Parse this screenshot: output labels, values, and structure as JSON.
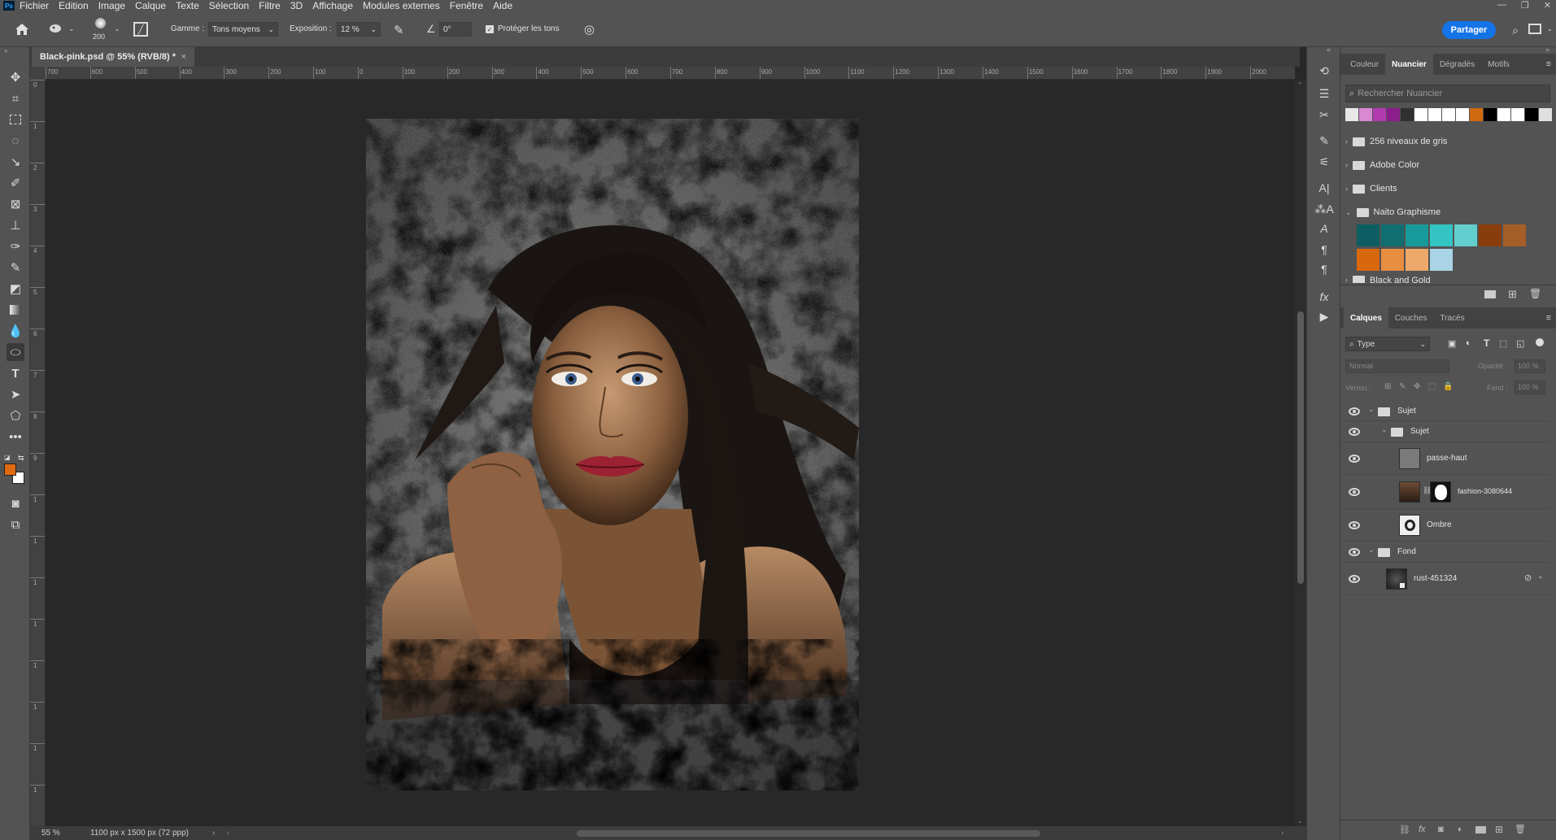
{
  "menubar": {
    "logo": "Ps",
    "items": [
      "Fichier",
      "Edition",
      "Image",
      "Calque",
      "Texte",
      "Sélection",
      "Filtre",
      "3D",
      "Affichage",
      "Modules externes",
      "Fenêtre",
      "Aide"
    ]
  },
  "options_bar": {
    "brush_size": "200",
    "range_label": "Gamme :",
    "range_value": "Tons moyens",
    "exposure_label": "Exposition :",
    "exposure_value": "12 %",
    "angle_value": "0°",
    "protect_tones_label": "Protéger les tons",
    "protect_tones_checked": true,
    "share_label": "Partager"
  },
  "document": {
    "tab_title": "Black-pink.psd @ 55% (RVB/8) *",
    "zoom": "55 %",
    "dimensions": "1100 px x 1500 px (72 ppp)"
  },
  "ruler": {
    "h_labels": [
      "700",
      "600",
      "500",
      "400",
      "300",
      "200",
      "100",
      "0",
      "100",
      "200",
      "300",
      "400",
      "500",
      "600",
      "700",
      "800",
      "900",
      "1000",
      "1100",
      "1200",
      "1300",
      "1400",
      "1500",
      "1600",
      "1700",
      "1800",
      "1900",
      "2000"
    ],
    "v_labels": [
      "0",
      "1",
      "2",
      "3",
      "4",
      "5",
      "6",
      "7",
      "8",
      "9",
      "1",
      "1",
      "1",
      "1",
      "1",
      "1",
      "1",
      "1"
    ]
  },
  "swatches_panel": {
    "tabs": [
      "Couleur",
      "Nuancier",
      "Dégradés",
      "Motifs"
    ],
    "active_tab": "Nuancier",
    "search_placeholder": "Rechercher Nuancier",
    "recent_colors": [
      "#e8e8e8",
      "#d88ad0",
      "#b03aae",
      "#8c1d8c",
      "#303030",
      "#ffffff",
      "#ffffff",
      "#ffffff",
      "#ffffff",
      "#d06a10",
      "#000000",
      "#ffffff",
      "#ffffff",
      "#000000",
      "#e0e0e0"
    ],
    "groups": [
      {
        "name": "256 niveaux de gris",
        "expanded": false
      },
      {
        "name": "Adobe Color",
        "expanded": false
      },
      {
        "name": "Clients",
        "expanded": false
      },
      {
        "name": "Naito Graphisme",
        "expanded": true
      }
    ],
    "naito_colors": [
      "#0d5e63",
      "#116e70",
      "#189a9a",
      "#34c4c4",
      "#62cece",
      "#8a3d0c",
      "#a55e28",
      "#d8680e",
      "#e88e40",
      "#eda96a",
      "#a8d4e6"
    ],
    "partial_group": "Black and Gold"
  },
  "layers_panel": {
    "tabs": [
      "Calques",
      "Couches",
      "Tracés"
    ],
    "active_tab": "Calques",
    "filter_label": "Type",
    "blend_mode": "Normal",
    "opacity_label": "Opacité :",
    "opacity_value": "100 %",
    "lock_label": "Verrou :",
    "fill_label": "Fond :",
    "fill_value": "100 %",
    "layers": [
      {
        "name": "Sujet",
        "type": "group",
        "indent": 0
      },
      {
        "name": "Sujet",
        "type": "group",
        "indent": 1
      },
      {
        "name": "passe-haut",
        "type": "layer",
        "indent": 2
      },
      {
        "name": "fashion-3080644",
        "type": "masked",
        "indent": 2
      },
      {
        "name": "Ombre",
        "type": "layer",
        "indent": 2
      },
      {
        "name": "Fond",
        "type": "group",
        "indent": 0
      },
      {
        "name": "rust-451324",
        "type": "smart",
        "indent": 1
      }
    ]
  },
  "colors": {
    "foreground": "#e06a10",
    "background": "#ffffff",
    "accent": "#1473e6"
  }
}
